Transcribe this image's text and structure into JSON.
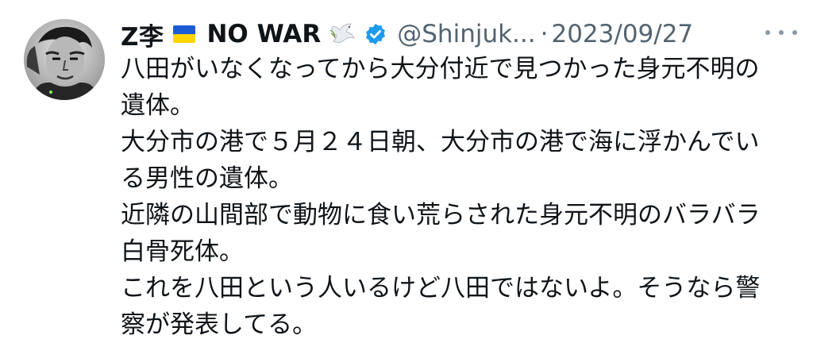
{
  "tweet": {
    "display_name": "Z李",
    "name_suffix": "NO WAR",
    "handle": "@Shinjuk...",
    "separator": "·",
    "date": "2023/09/27",
    "icons": [
      "avatar",
      "ukraine-flag-icon",
      "dove-icon",
      "verified-badge-icon",
      "more-options-icon"
    ],
    "colors": {
      "verified": "#1d9bf0",
      "secondary_text": "#536471",
      "primary_text": "#0f1419"
    },
    "body_lines": [
      "八田がいなくなってから大分付近で見つかった身元不明の",
      "遺体。",
      "大分市の港で５月２４日朝、大分市の港で海に浮かんでい",
      "る男性の遺体。",
      "近隣の山間部で動物に食い荒らされた身元不明のバラバラ",
      "白骨死体。",
      "これを八田という人いるけど八田ではないよ。そうなら警",
      "察が発表してる。"
    ]
  }
}
